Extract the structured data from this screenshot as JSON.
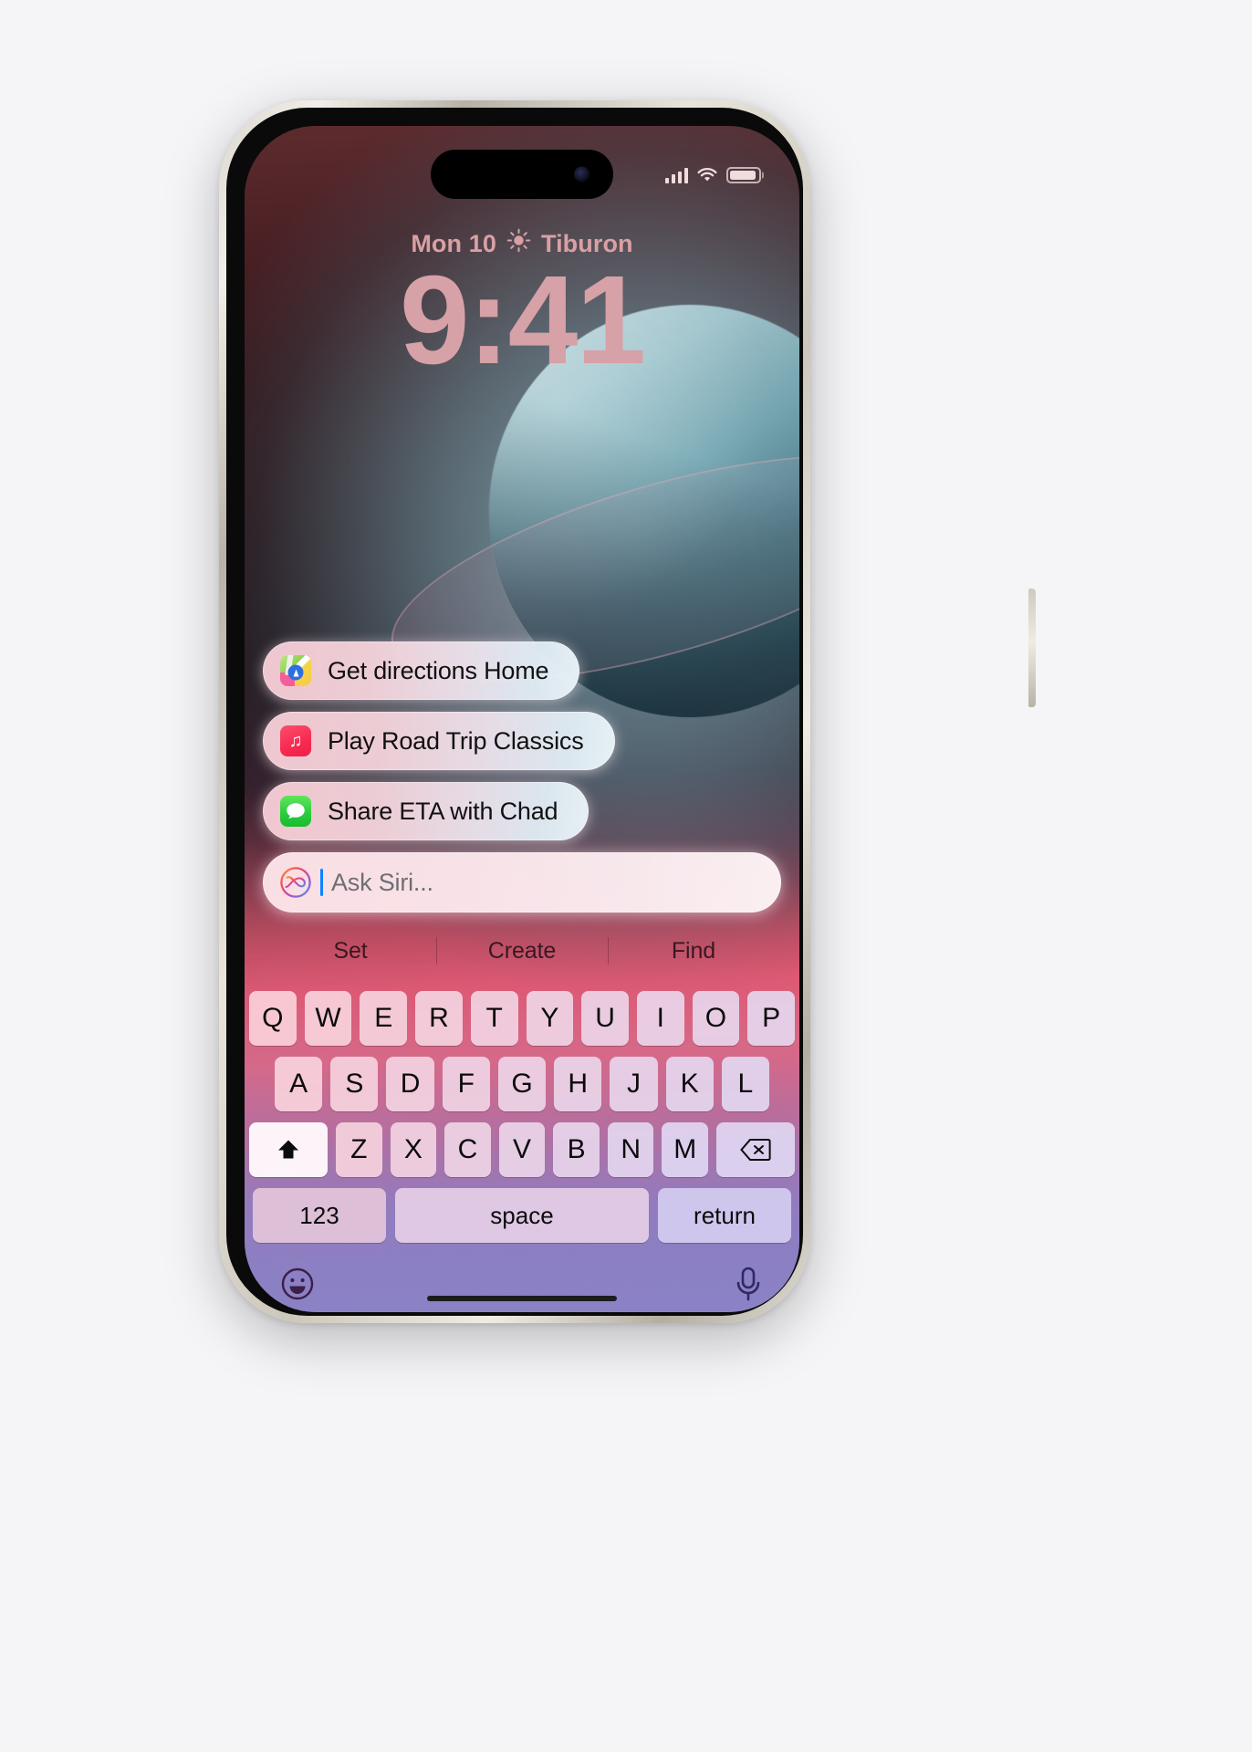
{
  "status_bar": {
    "signal_icon": "cellular-signal-icon",
    "wifi_icon": "wifi-icon",
    "battery_icon": "battery-icon"
  },
  "lock_screen": {
    "date": "Mon 10",
    "weather_icon": "sun-icon",
    "location": "Tiburon",
    "time": "9:41"
  },
  "siri": {
    "suggestions": [
      {
        "icon": "maps-app-icon",
        "label": "Get directions Home"
      },
      {
        "icon": "music-app-icon",
        "label": "Play Road Trip Classics"
      },
      {
        "icon": "messages-app-icon",
        "label": "Share ETA with Chad"
      }
    ],
    "input": {
      "orb_icon": "siri-orb-icon",
      "placeholder": "Ask Siri...",
      "value": ""
    },
    "categories": [
      "Set",
      "Create",
      "Find"
    ]
  },
  "keyboard": {
    "row1": [
      "Q",
      "W",
      "E",
      "R",
      "T",
      "Y",
      "U",
      "I",
      "O",
      "P"
    ],
    "row2": [
      "A",
      "S",
      "D",
      "F",
      "G",
      "H",
      "J",
      "K",
      "L"
    ],
    "row3_letters": [
      "Z",
      "X",
      "C",
      "V",
      "B",
      "N",
      "M"
    ],
    "shift_icon": "shift-arrow-icon",
    "shift_state": "active",
    "backspace_icon": "backspace-icon",
    "numeric_key": "123",
    "space_key": "space",
    "return_key": "return",
    "emoji_icon": "emoji-smiley-icon",
    "dictation_icon": "microphone-icon"
  },
  "colors": {
    "accent_caret": "#0A84FF",
    "clock_text": "#D6A1A7",
    "messages_green": "#2ECC3F",
    "music_red": "#F82C52",
    "maps_blue": "#2D6FE0"
  }
}
